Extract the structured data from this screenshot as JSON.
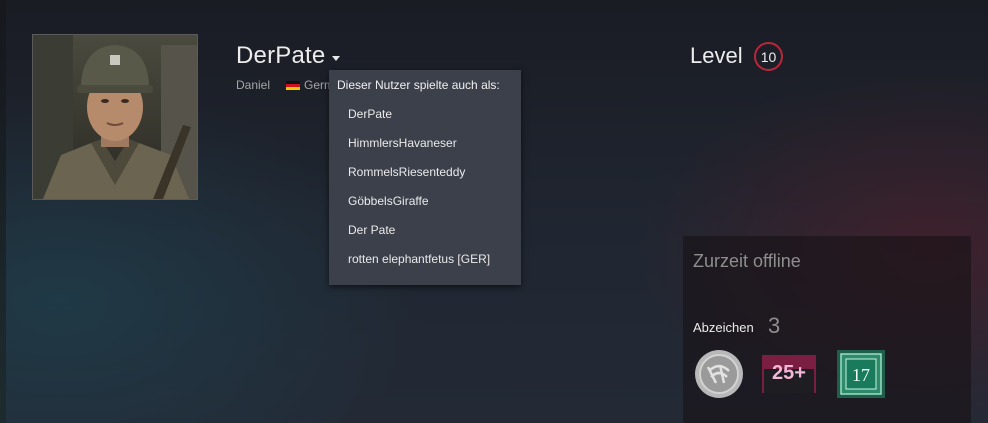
{
  "profile": {
    "persona_name": "DerPate",
    "real_name": "Daniel",
    "country": "Germany",
    "country_visible": "Germ",
    "level_label": "Level",
    "level": "10",
    "level_color": "#b8283a"
  },
  "aliases": {
    "title": "Dieser Nutzer spielte auch als:",
    "items": [
      "DerPate",
      "HimmlersHavaneser",
      "RommelsRiesenteddy",
      "GöbbelsGiraffe",
      "Der Pate",
      "rotten elephantfetus [GER]"
    ]
  },
  "status": {
    "text": "Zurzeit offline",
    "badges_label": "Abzeichen",
    "badges_count": "3",
    "badges": [
      {
        "icon": "silver-coin-badge-icon"
      },
      {
        "icon": "years-of-service-badge-icon",
        "text": "25+"
      },
      {
        "icon": "calendar-badge-icon",
        "text": "17"
      }
    ]
  }
}
